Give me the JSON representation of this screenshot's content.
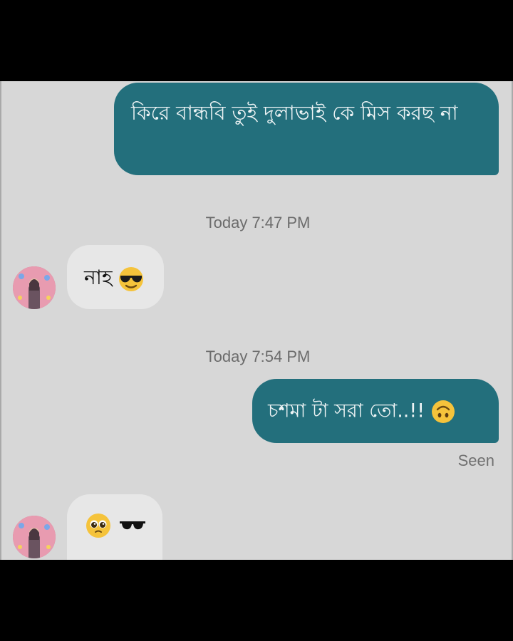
{
  "messages": {
    "m1": {
      "text": "কিরে বান্ধবি তুই দুলাভাই কে মিস করছ না"
    },
    "time1": "Today 7:47 PM",
    "m2": {
      "text": "নাহ",
      "emoji": "sunglasses-face"
    },
    "time2": "Today 7:54 PM",
    "m3": {
      "text": "চশমা টা সরা তো..!!",
      "emoji": "upside-down-face"
    },
    "seen": "Seen",
    "m4": {
      "emoji": [
        "pleading-face",
        "dark-sunglasses"
      ]
    }
  },
  "colors": {
    "outgoing_bubble": "#236f7c",
    "incoming_bubble": "#e7e7e7",
    "background": "#d7d7d7"
  }
}
